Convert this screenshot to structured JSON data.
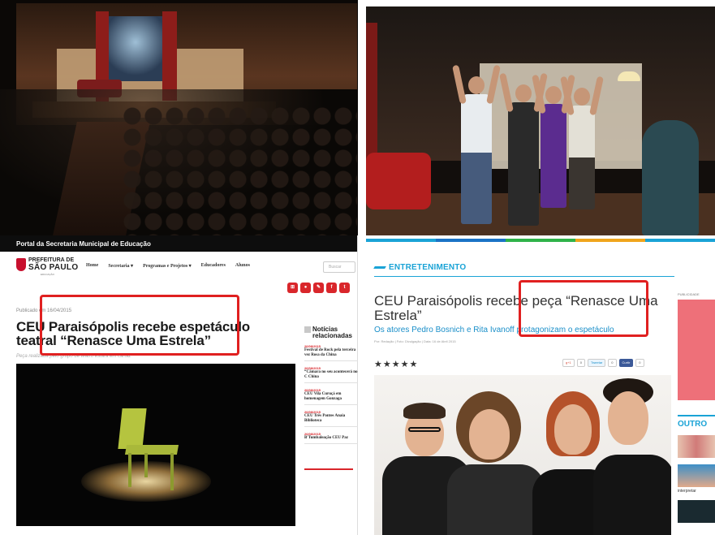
{
  "portal": {
    "topbar_title": "Portal da Secretaria Municipal de Educação",
    "logo": {
      "line1": "PREFEITURA DE",
      "line2": "SÃO PAULO",
      "line3": "EDUCAÇÃO"
    },
    "menu": [
      "Home",
      "Secretaria ▾",
      "Programas e Projetos ▾",
      "Educadores",
      "Alunos"
    ],
    "search_placeholder": "Buscar",
    "social_icons": [
      "sitemap-icon",
      "chat-icon",
      "edit-icon",
      "facebook-icon",
      "twitter-icon"
    ],
    "published": "Publicado em 16/04/2015",
    "headline": "CEU Paraisópolis recebe espetáculo teatral “Renasce Uma Estrela”",
    "subline": "Peça realizada pelo grupo de teatro estará em cartaz",
    "sidebar": {
      "title": "Notícias relacionadas",
      "items": [
        {
          "date": "26/08/2015",
          "text": "Festival de Rock pela terceira vez Rosa da China"
        },
        {
          "date": "26/08/2015",
          "text": "“Câmara no seu acontecerá no C China"
        },
        {
          "date": "26/08/2015",
          "text": "CEU Vila Curuçá em homenagem Gonzaga"
        },
        {
          "date": "26/08/2015",
          "text": "CEU Três Pontes Anaia Biblioteca"
        },
        {
          "date": "26/08/2015",
          "text": "B'Tumbaleação CEU Paz"
        }
      ]
    }
  },
  "news": {
    "stripe_colors": [
      "#1aa3d6",
      "#1a73c6",
      "#2fb34a",
      "#f0a51c",
      "#1aa3d6"
    ],
    "section": "ENTRETENIMENTO",
    "headline": "CEU Paraisópolis recebe peça “Renasce Uma Estrela”",
    "subtitle": "Os atores Pedro Bosnich e Rita Ivanoff protagonizam o espetáculo",
    "meta": "Por: Redação | Foto: Divulgação | Data: 16 de Abril 2015",
    "stars": "★★★★★",
    "share": {
      "gplus": "g+1",
      "gplus_count": "0",
      "tweet": "Tweetar",
      "tweet_count": "0",
      "fb": "Curtir",
      "fb_count": "0"
    },
    "right": {
      "pub_label": "PUBLICIDADE",
      "outros": "OUTRO",
      "interp": "interpretar"
    }
  },
  "colors": {
    "highlight": "#e02020",
    "accent": "#1aa3d6",
    "portal_red": "#d9262b"
  }
}
